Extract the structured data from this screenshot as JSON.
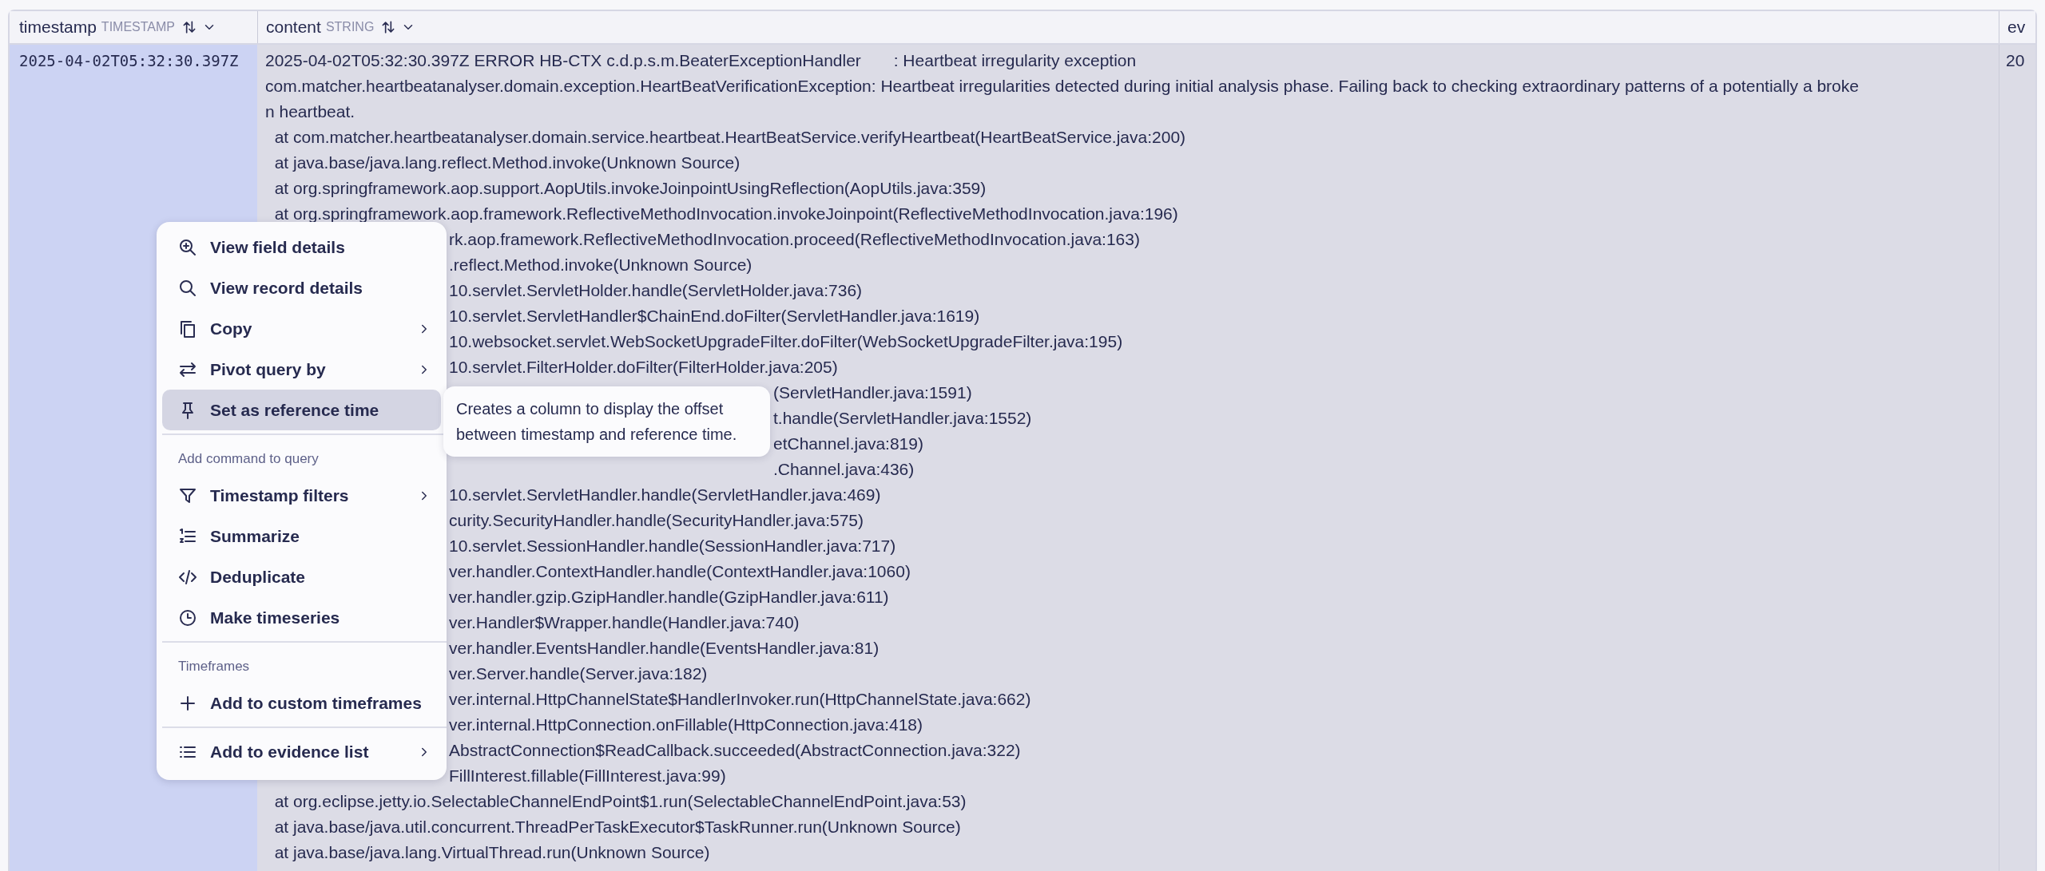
{
  "table": {
    "columns": [
      {
        "name": "timestamp",
        "type": "TIMESTAMP"
      },
      {
        "name": "content",
        "type": "STRING"
      },
      {
        "name": "ev"
      }
    ],
    "rows": [
      {
        "timestamp": {
          "text": "2025-04-02T05:32:30.397Z",
          "selected": true
        },
        "content_lines": [
          {
            "kind": "full",
            "text": "2025-04-02T05:32:30.397Z ERROR HB-CTX c.d.p.s.m.BeaterExceptionHandler       : Heartbeat irregularity exception"
          },
          {
            "kind": "full",
            "text": "com.matcher.heartbeatanalyser.domain.exception.HeartBeatVerificationException: Heartbeat irregularities detected during initial analysis phase. Failing back to checking extraordinary patterns of a potentially a broke"
          },
          {
            "kind": "full",
            "text": "n heartbeat."
          },
          {
            "kind": "full",
            "text": "  at com.matcher.heartbeatanalyser.domain.service.heartbeat.HeartBeatService.verifyHeartbeat(HeartBeatService.java:200)"
          },
          {
            "kind": "full",
            "text": "  at java.base/java.lang.reflect.Method.invoke(Unknown Source)"
          },
          {
            "kind": "full",
            "text": "  at org.springframework.aop.support.AopUtils.invokeJoinpointUsingReflection(AopUtils.java:359)"
          },
          {
            "kind": "full",
            "text": "  at org.springframework.aop.framework.ReflectiveMethodInvocation.invokeJoinpoint(ReflectiveMethodInvocation.java:196)"
          },
          {
            "kind": "menu",
            "text": "rk.aop.framework.ReflectiveMethodInvocation.proceed(ReflectiveMethodInvocation.java:163)"
          },
          {
            "kind": "menu",
            "text": ".reflect.Method.invoke(Unknown Source)"
          },
          {
            "kind": "menu",
            "text": "10.servlet.ServletHolder.handle(ServletHolder.java:736)"
          },
          {
            "kind": "menu",
            "text": "10.servlet.ServletHandler$ChainEnd.doFilter(ServletHandler.java:1619)"
          },
          {
            "kind": "menu",
            "text": "10.websocket.servlet.WebSocketUpgradeFilter.doFilter(WebSocketUpgradeFilter.java:195)"
          },
          {
            "kind": "menu",
            "text": "10.servlet.FilterHolder.doFilter(FilterHolder.java:205)"
          },
          {
            "kind": "tip",
            "text": "(ServletHandler.java:1591)"
          },
          {
            "kind": "tip",
            "text": "t.handle(ServletHandler.java:1552)"
          },
          {
            "kind": "tip",
            "text": "etChannel.java:819)"
          },
          {
            "kind": "tip",
            "text": ".Channel.java:436)"
          },
          {
            "kind": "menu",
            "text": "10.servlet.ServletHandler.handle(ServletHandler.java:469)"
          },
          {
            "kind": "menu",
            "text": "curity.SecurityHandler.handle(SecurityHandler.java:575)"
          },
          {
            "kind": "menu",
            "text": "10.servlet.SessionHandler.handle(SessionHandler.java:717)"
          },
          {
            "kind": "menu",
            "text": "ver.handler.ContextHandler.handle(ContextHandler.java:1060)"
          },
          {
            "kind": "menu",
            "text": "ver.handler.gzip.GzipHandler.handle(GzipHandler.java:611)"
          },
          {
            "kind": "menu",
            "text": "ver.Handler$Wrapper.handle(Handler.java:740)"
          },
          {
            "kind": "menu",
            "text": "ver.handler.EventsHandler.handle(EventsHandler.java:81)"
          },
          {
            "kind": "menu",
            "text": "ver.Server.handle(Server.java:182)"
          },
          {
            "kind": "menu",
            "text": "ver.internal.HttpChannelState$HandlerInvoker.run(HttpChannelState.java:662)"
          },
          {
            "kind": "menu",
            "text": "ver.internal.HttpConnection.onFillable(HttpConnection.java:418)"
          },
          {
            "kind": "menu",
            "text": "AbstractConnection$ReadCallback.succeeded(AbstractConnection.java:322)"
          },
          {
            "kind": "menu",
            "text": "FillInterest.fillable(FillInterest.java:99)"
          },
          {
            "kind": "full",
            "text": "  at org.eclipse.jetty.io.SelectableChannelEndPoint$1.run(SelectableChannelEndPoint.java:53)"
          },
          {
            "kind": "full",
            "text": "  at java.base/java.util.concurrent.ThreadPerTaskExecutor$TaskRunner.run(Unknown Source)"
          },
          {
            "kind": "full",
            "text": "  at java.base/java.lang.VirtualThread.run(Unknown Source)"
          }
        ],
        "column_3": "20"
      }
    ]
  },
  "context_menu": {
    "sections": [
      {
        "items": [
          {
            "label": "View field details",
            "submenu": false,
            "selected": false
          },
          {
            "label": "View record details",
            "submenu": false,
            "selected": false
          },
          {
            "label": "Copy",
            "submenu": true,
            "selected": false
          },
          {
            "label": "Pivot query by",
            "submenu": true,
            "selected": false
          },
          {
            "label": "Set as reference time",
            "submenu": false,
            "selected": true
          }
        ]
      },
      {
        "title": "Add command to query",
        "items": [
          {
            "label": "Timestamp filters",
            "submenu": true,
            "selected": false
          },
          {
            "label": "Summarize",
            "submenu": false,
            "selected": false
          },
          {
            "label": "Deduplicate",
            "submenu": false,
            "selected": false
          },
          {
            "label": "Make timeseries",
            "submenu": false,
            "selected": false
          }
        ]
      },
      {
        "title": "Timeframes",
        "items": [
          {
            "label": "Add to custom timeframes",
            "submenu": false,
            "selected": false
          }
        ]
      },
      {
        "items": [
          {
            "label": "Add to evidence list",
            "submenu": true,
            "selected": false
          }
        ]
      }
    ]
  },
  "tooltip": {
    "text": "Creates a column to display the offset between timestamp and reference time."
  }
}
